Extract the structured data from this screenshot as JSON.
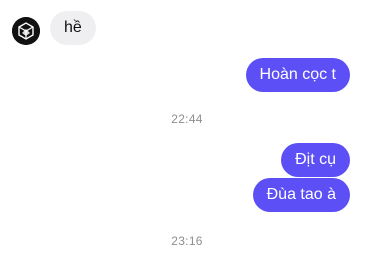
{
  "conversation": {
    "avatar_icon": "black-geometric-logo",
    "colors": {
      "outgoing_bubble": "#5b4ff5",
      "incoming_bubble": "#efeff1",
      "timestamp_text": "#8e8e93"
    },
    "messages": [
      {
        "direction": "incoming",
        "text": "hề"
      },
      {
        "direction": "outgoing",
        "text": "Hoàn cọc t"
      },
      {
        "direction": "outgoing",
        "text": "Địt cụ"
      },
      {
        "direction": "outgoing",
        "text": "Đùa tao à"
      }
    ],
    "timestamps": [
      "22:44",
      "23:16"
    ]
  }
}
